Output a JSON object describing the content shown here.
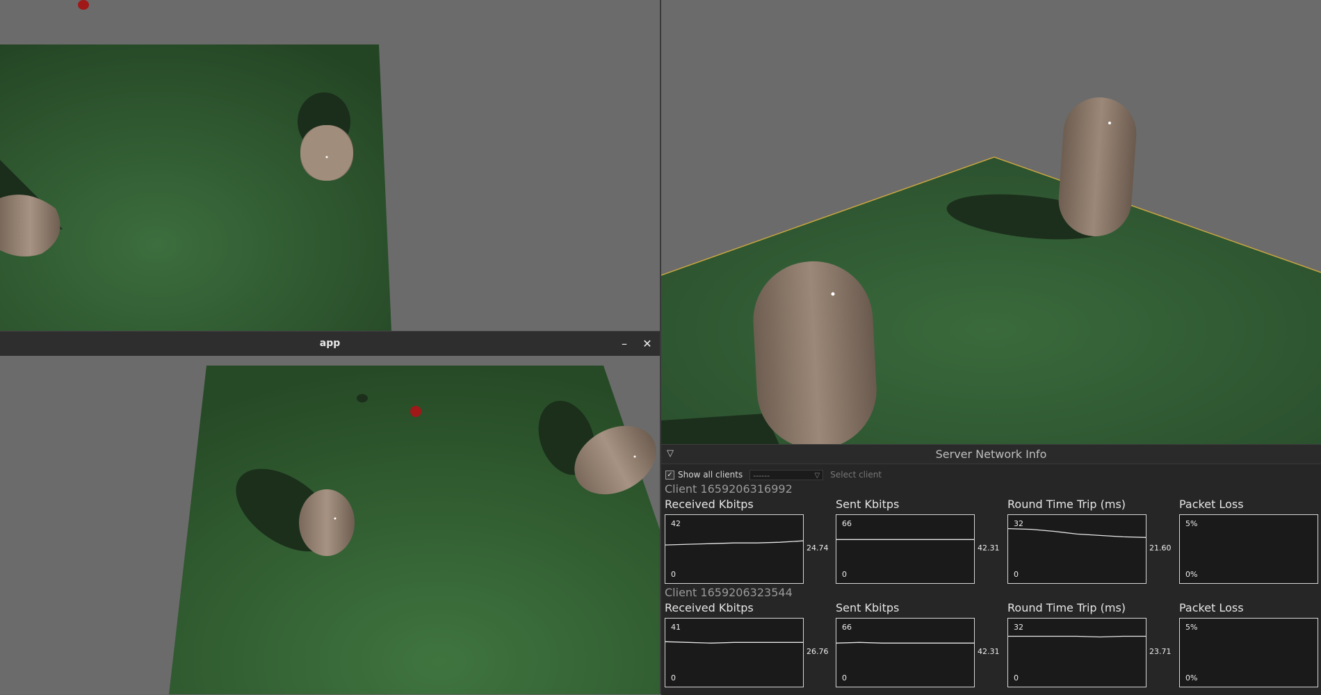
{
  "window": {
    "title": "app"
  },
  "panel": {
    "title": "Server Network Info",
    "show_all_clients": {
      "label": "Show all clients",
      "checked": true
    },
    "client_select_value": "------",
    "select_client_label": "Select client",
    "clients": [
      {
        "label": "Client 1659206316992",
        "metrics": [
          {
            "title": "Received Kbitps",
            "max": "42",
            "min": "0",
            "current": "24.74",
            "trend": [
              0.56,
              0.57,
              0.58,
              0.59,
              0.59,
              0.6,
              0.62
            ]
          },
          {
            "title": "Sent Kbitps",
            "max": "66",
            "min": "0",
            "current": "42.31",
            "trend": [
              0.64,
              0.64,
              0.64,
              0.64,
              0.64,
              0.64,
              0.64
            ]
          },
          {
            "title": "Round Time Trip (ms)",
            "max": "32",
            "min": "0",
            "current": "21.60",
            "trend": [
              0.8,
              0.79,
              0.76,
              0.72,
              0.7,
              0.68,
              0.67
            ]
          },
          {
            "title": "Packet Loss",
            "max": "5%",
            "min": "0%",
            "current": "",
            "trend": []
          }
        ]
      },
      {
        "label": "Client 1659206323544",
        "metrics": [
          {
            "title": "Received Kbitps",
            "max": "41",
            "min": "0",
            "current": "26.76",
            "trend": [
              0.66,
              0.65,
              0.64,
              0.65,
              0.65,
              0.65,
              0.65
            ]
          },
          {
            "title": "Sent Kbitps",
            "max": "66",
            "min": "0",
            "current": "42.31",
            "trend": [
              0.64,
              0.65,
              0.64,
              0.64,
              0.64,
              0.64,
              0.64
            ]
          },
          {
            "title": "Round Time Trip (ms)",
            "max": "32",
            "min": "0",
            "current": "23.71",
            "trend": [
              0.74,
              0.74,
              0.74,
              0.74,
              0.73,
              0.74,
              0.74
            ]
          },
          {
            "title": "Packet Loss",
            "max": "5%",
            "min": "0%",
            "current": "",
            "trend": []
          }
        ]
      }
    ]
  },
  "colors": {
    "ground": "#2f5530",
    "capsule": "#9a8674",
    "ball": "#a01818",
    "background": "#6b6b6b",
    "panel": "#262626"
  }
}
